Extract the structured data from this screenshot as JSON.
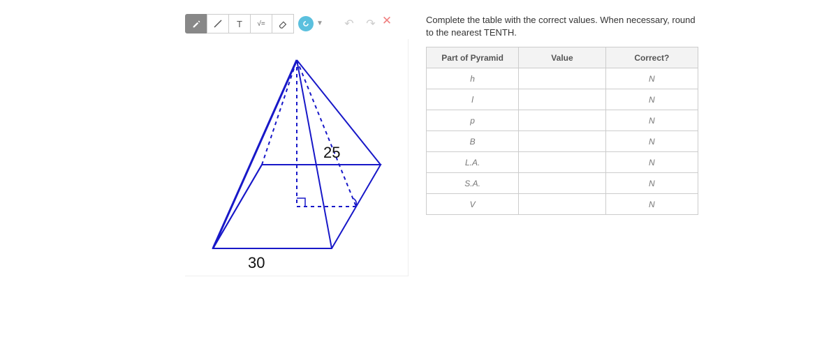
{
  "toolbar": {
    "pencil_active": "pencil-icon",
    "line": "line-icon",
    "text_label": "T",
    "math_label": "√=",
    "eraser": "eraser-icon",
    "highlighter": "hl-icon",
    "undo": "↶",
    "redo": "↷",
    "close": "✕"
  },
  "figure": {
    "slant_label": "25",
    "base_label": "30"
  },
  "instructions": "Complete the table with the correct values.  When necessary, round to the nearest TENTH.",
  "table": {
    "headers": {
      "c1": "Part of Pyramid",
      "c2": "Value",
      "c3": "Correct?"
    },
    "rows": [
      {
        "part": "h",
        "value": "",
        "correct": "N"
      },
      {
        "part": "l",
        "value": "",
        "correct": "N"
      },
      {
        "part": "p",
        "value": "",
        "correct": "N"
      },
      {
        "part": "B",
        "value": "",
        "correct": "N"
      },
      {
        "part": "L.A.",
        "value": "",
        "correct": "N"
      },
      {
        "part": "S.A.",
        "value": "",
        "correct": "N"
      },
      {
        "part": "V",
        "value": "",
        "correct": "N"
      }
    ]
  }
}
